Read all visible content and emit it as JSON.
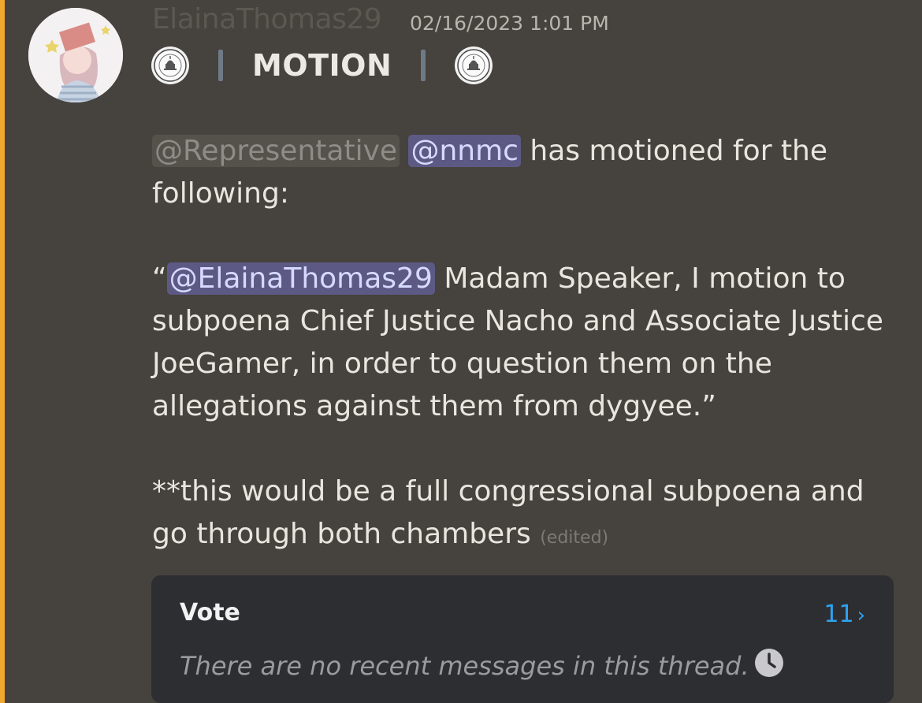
{
  "message": {
    "author": "ElainaThomas29",
    "timestamp": "02/16/2023 1:01 PM",
    "title": "MOTION",
    "mention_role": "@Representative",
    "mention_user_1": "@nnmc",
    "line1_rest": " has motioned for the following:",
    "open_quote": "“",
    "mention_user_2": "@ElainaThomas29",
    "quote_text": " Madam Speaker, I motion to subpoena Chief Justice Nacho and Associate Justice JoeGamer, in order to question them on the allegations against them from dygyee.”",
    "note_text": "**this would be a full congressional subpoena and go through both chambers ",
    "edited_label": "(edited)"
  },
  "thread": {
    "name": "Vote",
    "count": "11",
    "status": "There are no recent messages in this thread."
  },
  "icons": {
    "seal": "capitol-seal-icon",
    "clock": "clock-icon",
    "chevron": "chevron-right-icon"
  },
  "colors": {
    "background": "#46423d",
    "accent": "#f0a830",
    "mention_bg": "#5c5a85",
    "link": "#2ea3f2"
  }
}
